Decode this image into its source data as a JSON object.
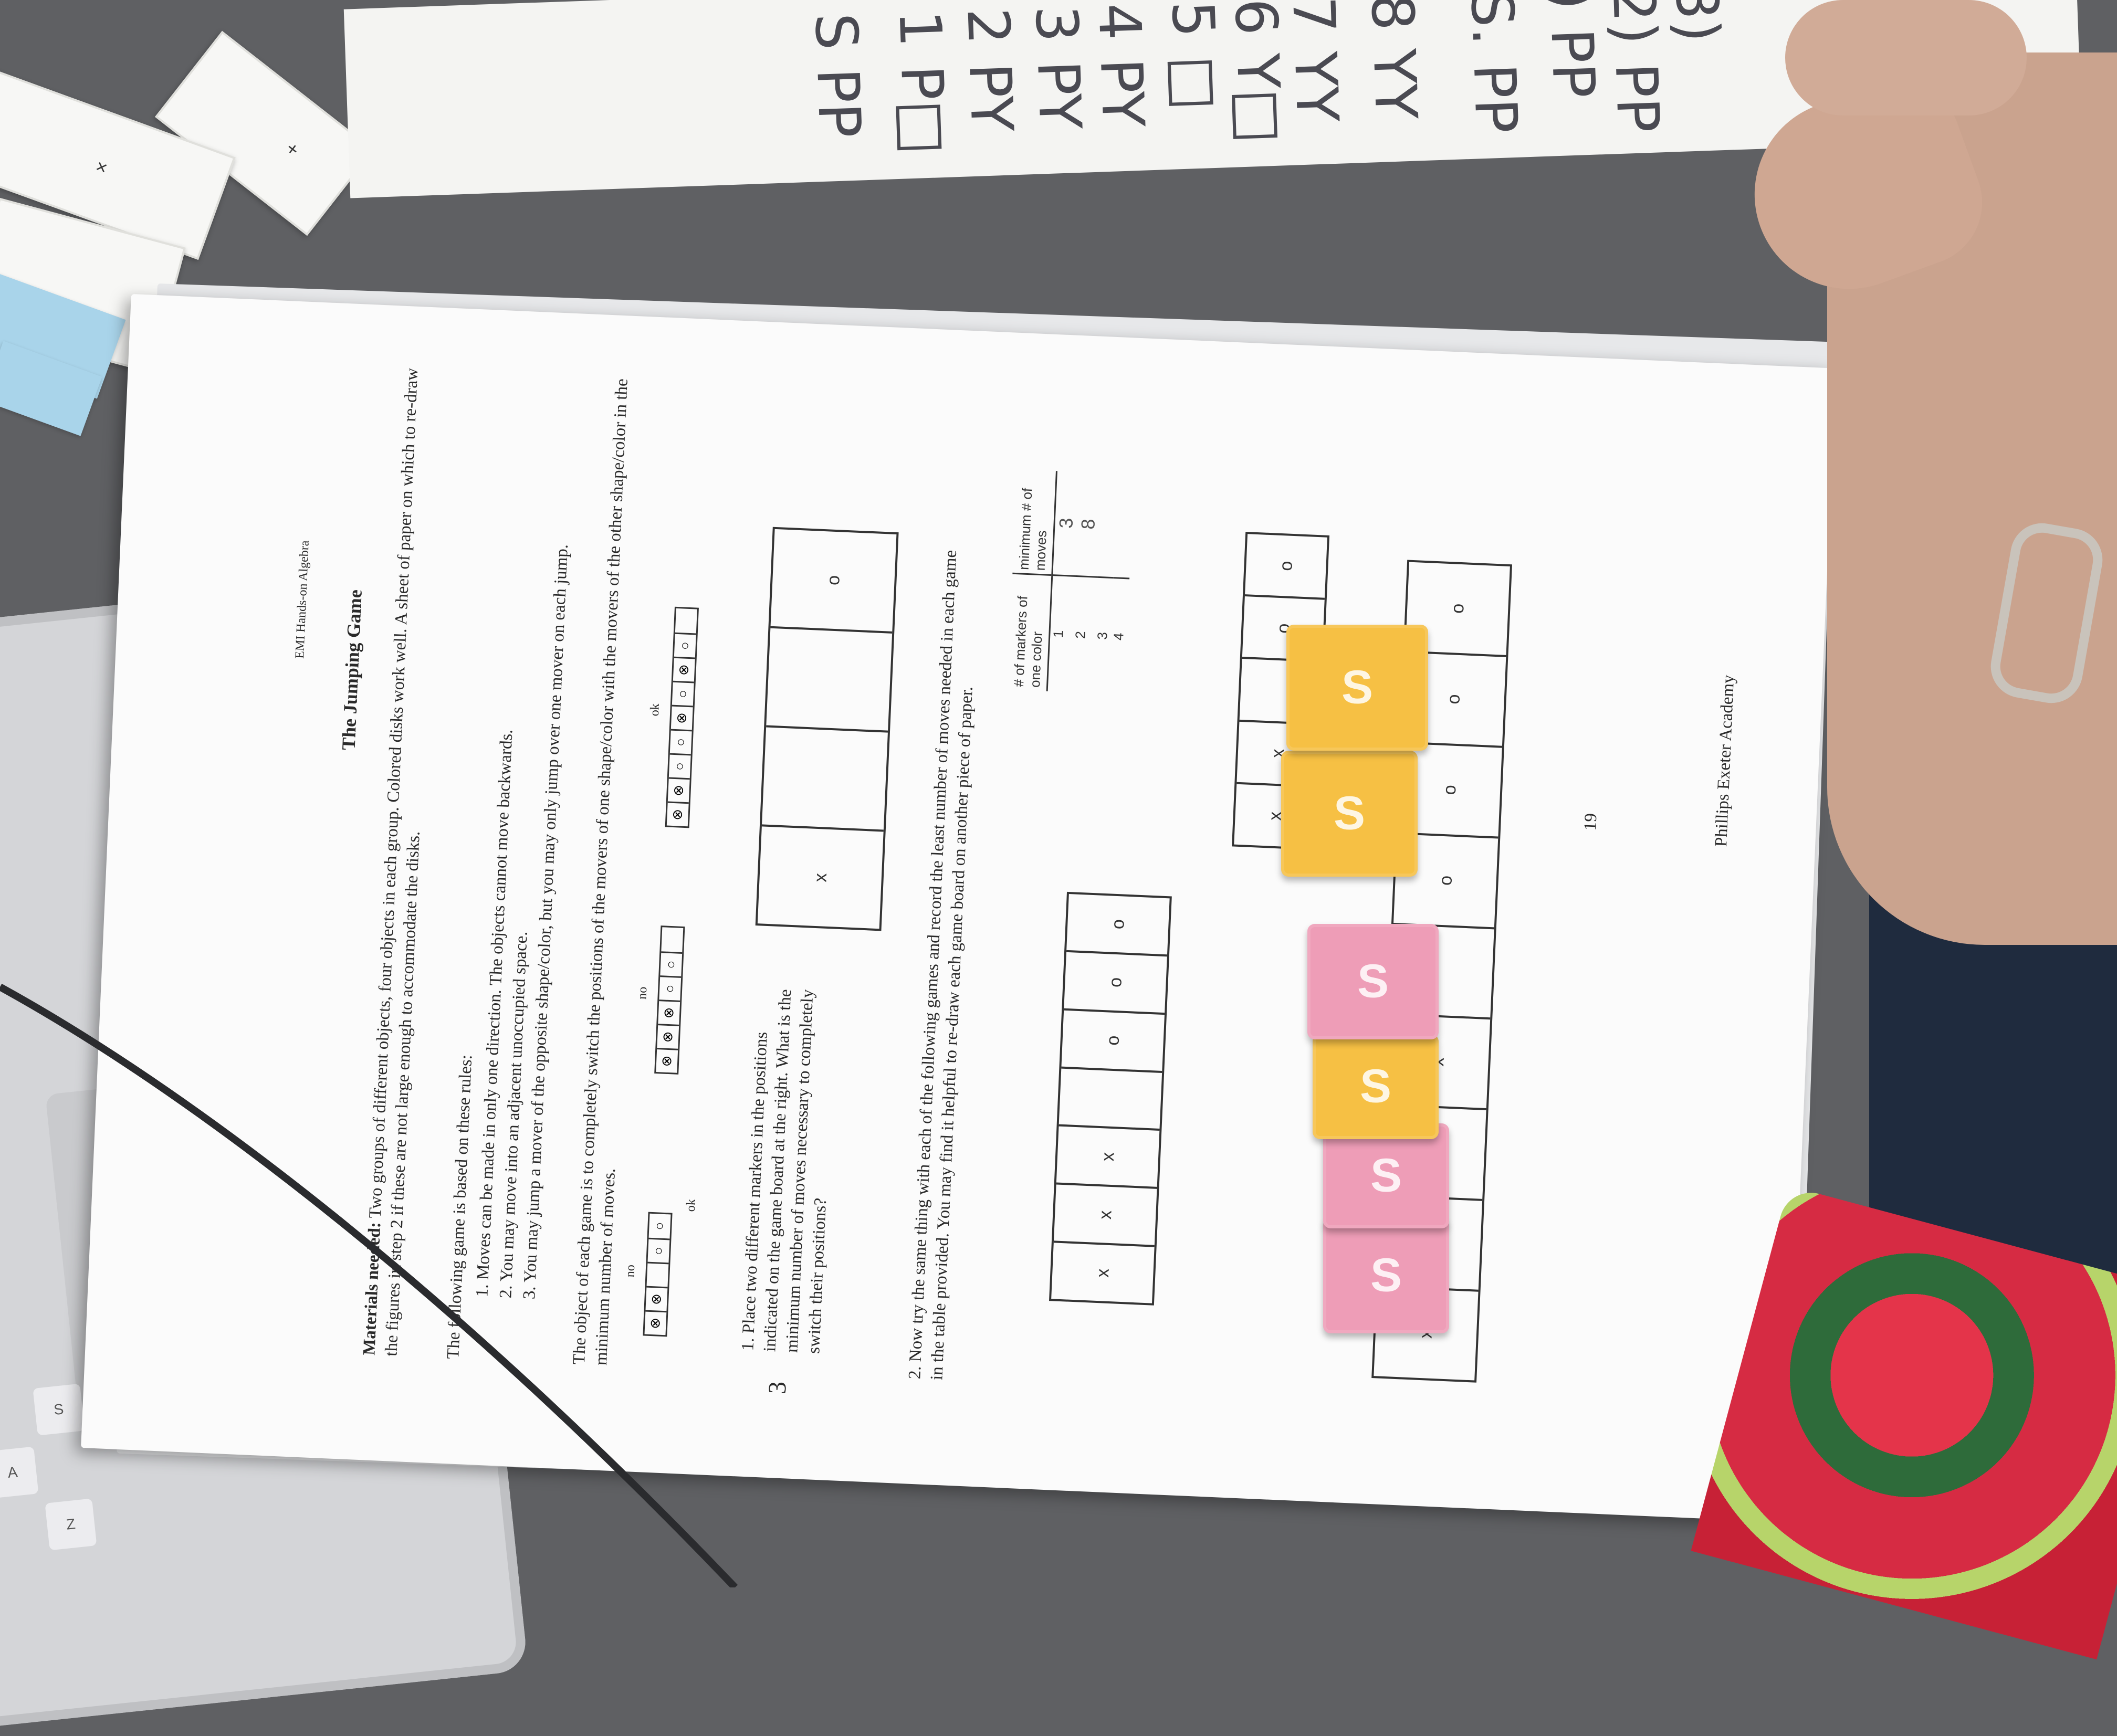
{
  "cards": {
    "sign_plus": "+",
    "sign_times": "×"
  },
  "handwritten": {
    "lines": [
      "S PP",
      "1 P□",
      "2 PY",
      "3 PY",
      "4 PY",
      "5 □",
      "6 Y□",
      "7 YY",
      "8 YY",
      "S. PP",
      ") PP",
      "2) PP",
      "3)"
    ]
  },
  "laptop": {
    "keys": [
      "Z",
      "A",
      "S"
    ]
  },
  "worksheet": {
    "header": "EMI Hands-on Algebra",
    "title": "The Jumping Game",
    "materials_label": "Materials needed:",
    "materials_text": "Two groups of different objects, four objects in each group. Colored disks work well. A sheet of paper on which to re-draw the figures in step 2 if these are not large enough to accommodate the disks.",
    "rules_intro": "The following game is based on these rules:",
    "rules": [
      "1. Moves can be made in only one direction. The objects cannot move backwards.",
      "2. You may move into an adjacent unoccupied space.",
      "3. You may jump a mover of the opposite shape/color, but you may only jump over one mover on each jump."
    ],
    "objective": "The object of each game is to completely switch the positions of the movers of one shape/color with the movers of the other shape/color in the minimum number of moves.",
    "example_labels": [
      "no",
      "ok",
      "no",
      "ok"
    ],
    "q1_num": "3",
    "q1": "1. Place two different markers in the positions indicated on the game board at the right. What is the minimum number of moves necessary to completely switch their positions?",
    "board1": [
      "x",
      "",
      "",
      "o"
    ],
    "q2": "2. Now try the same thing with each of the following games and record the least number of moves needed in each game in the table provided. You may find it helpful to re-draw each game board on another piece of paper.",
    "table": {
      "headers": [
        "# of markers of one color",
        "minimum # of moves"
      ],
      "rows": [
        [
          "1",
          "3"
        ],
        [
          "2",
          "8"
        ],
        [
          "3",
          ""
        ],
        [
          "4",
          ""
        ]
      ]
    },
    "board2": [
      "x",
      "x",
      "",
      "o",
      "o"
    ],
    "board3": [
      "x",
      "x",
      "x",
      "",
      "o",
      "o",
      "o"
    ],
    "board4": [
      "x",
      "x",
      "x",
      "x",
      "",
      "o",
      "o",
      "o",
      "o"
    ],
    "footer": "Phillips Exeter Academy",
    "page_number": "19"
  },
  "candies": [
    {
      "color": "#ee9db7",
      "logo": "S"
    },
    {
      "color": "#ee9db7",
      "logo": "S"
    },
    {
      "color": "#f6c044",
      "logo": "S"
    },
    {
      "color": "#ee9db7",
      "logo": "S"
    },
    {
      "color": "#f6c044",
      "logo": "S"
    },
    {
      "color": "#f6c044",
      "logo": "S"
    }
  ]
}
